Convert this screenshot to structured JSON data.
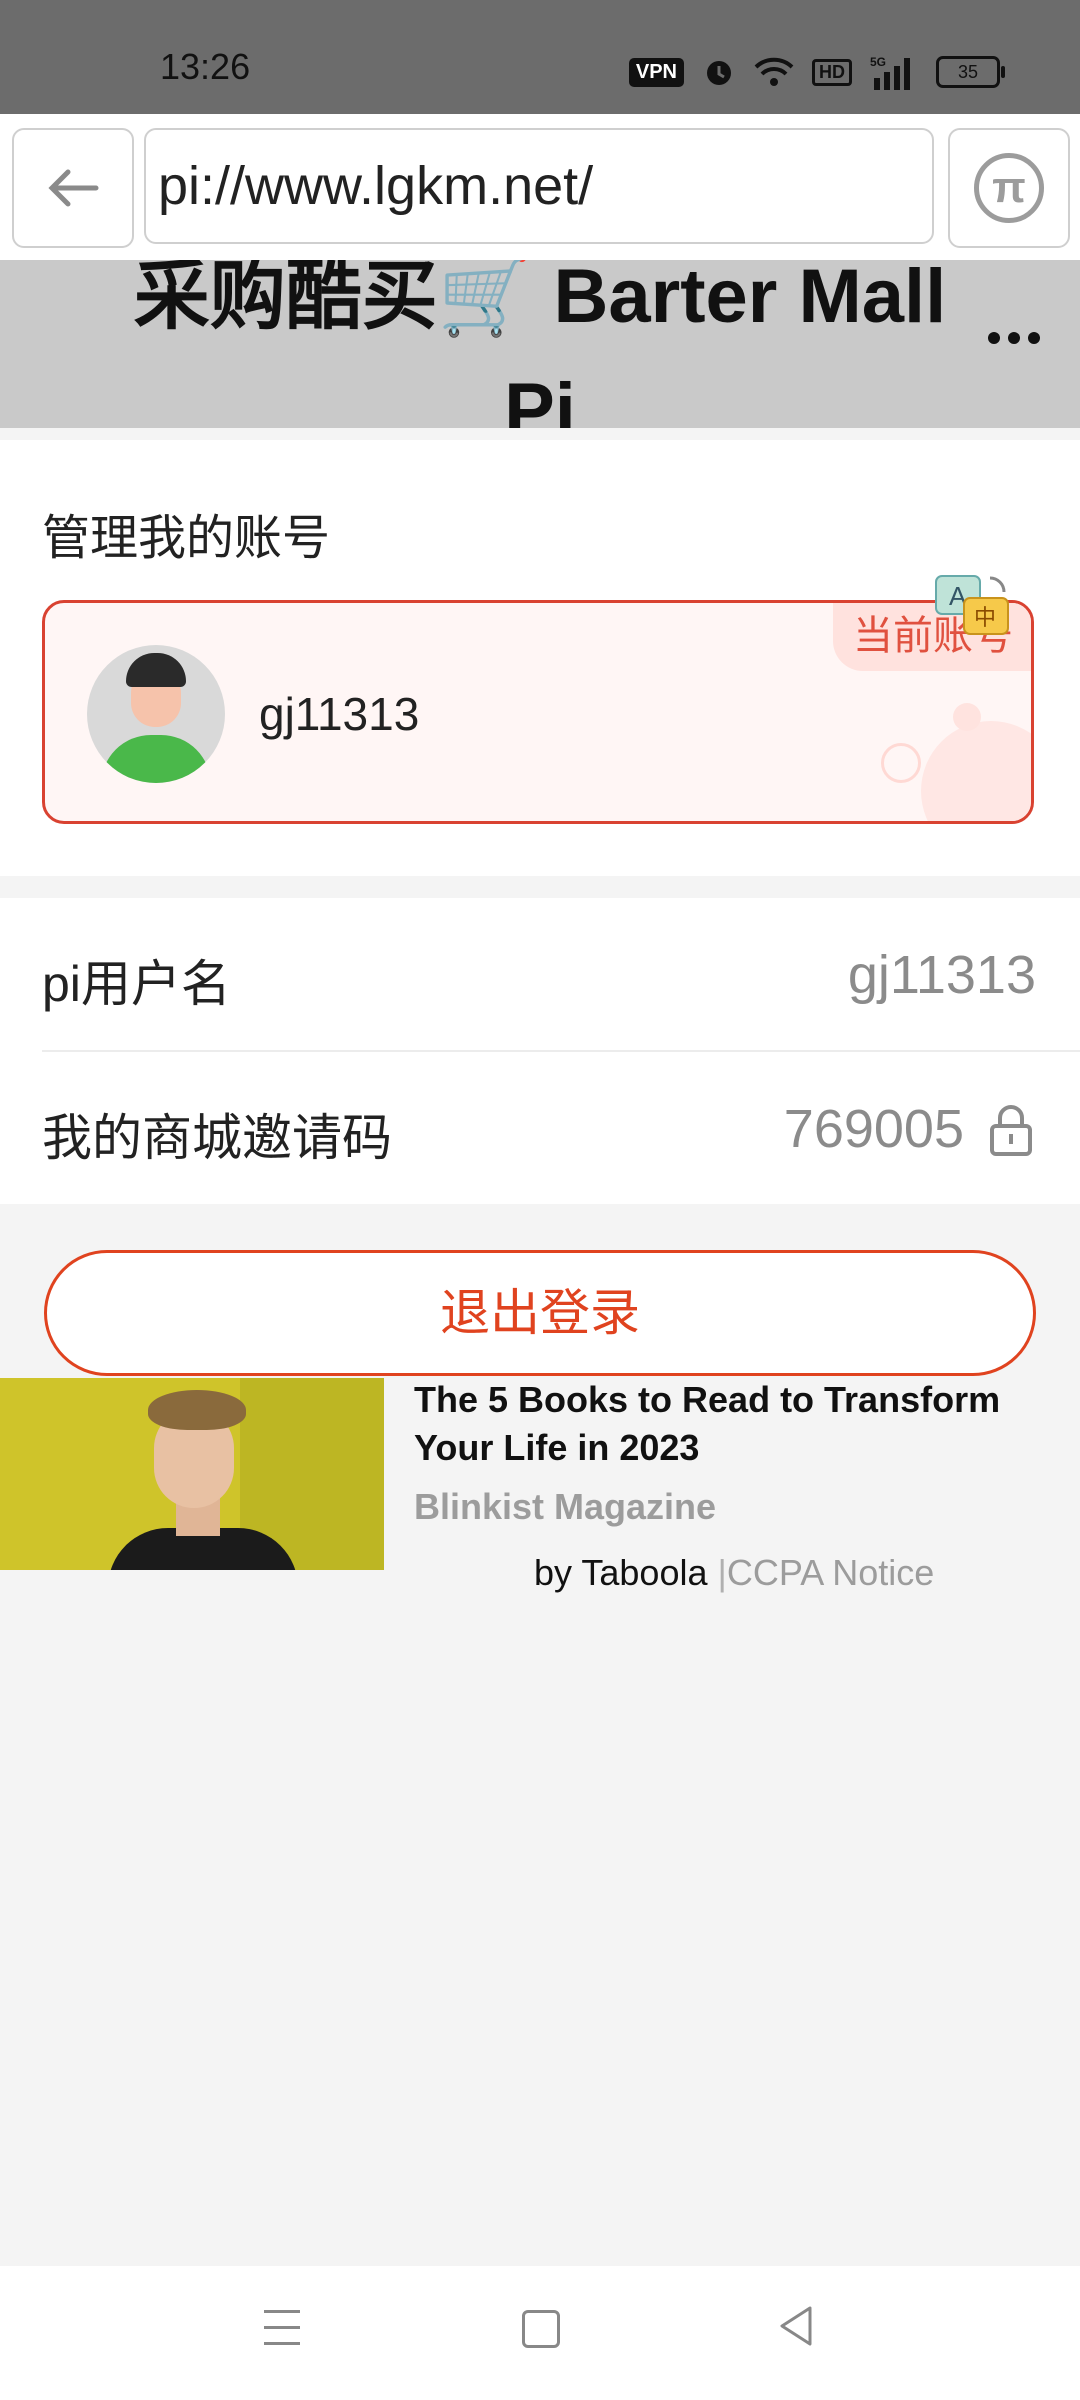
{
  "status_bar": {
    "time": "13:26",
    "vpn": "VPN",
    "hd": "HD",
    "network": "5G",
    "battery": "35"
  },
  "browser": {
    "url": "pi://www.lgkm.net/"
  },
  "header": {
    "title": "采购酷买🛒 Barter Mall Pi"
  },
  "account_section": {
    "title": "管理我的账号",
    "account_name": "gj11313",
    "current_badge": "当前账号"
  },
  "info": {
    "pi_username_label": "pi用户名",
    "pi_username_value": "gj11313",
    "invite_code_label": "我的商城邀请码",
    "invite_code_value": "769005"
  },
  "logout_label": "退出登录",
  "ad": {
    "title": "The 5 Books to Read to Transform Your Life in 2023",
    "source": "Blinkist Magazine",
    "by": "by Taboola",
    "separator": "|",
    "ccpa": "CCPA Notice"
  },
  "colors": {
    "accent": "#e0431f",
    "card_border": "#d94231",
    "status_bar": "#6c6c6c"
  }
}
